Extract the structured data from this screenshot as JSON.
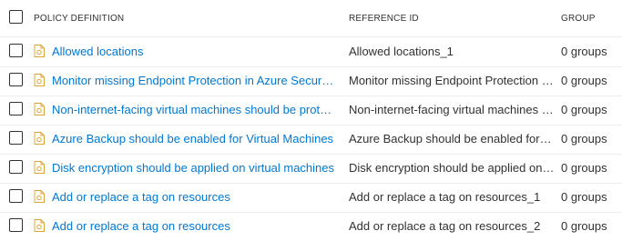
{
  "table": {
    "headers": {
      "policy_definition": "POLICY DEFINITION",
      "reference_id": "REFERENCE ID",
      "group": "GROUP"
    },
    "rows": [
      {
        "policy_definition": "Allowed locations",
        "reference_id": "Allowed locations_1",
        "group": "0 groups"
      },
      {
        "policy_definition": "Monitor missing Endpoint Protection in Azure Security Center",
        "reference_id": "Monitor missing Endpoint Protection in Azure Security Center",
        "group": "0 groups"
      },
      {
        "policy_definition": "Non-internet-facing virtual machines should be protected with network security groups",
        "reference_id": "Non-internet-facing virtual machines should be protected with network security groups",
        "group": "0 groups"
      },
      {
        "policy_definition": "Azure Backup should be enabled for Virtual Machines",
        "reference_id": "Azure Backup should be enabled for Virtual Machines",
        "group": "0 groups"
      },
      {
        "policy_definition": "Disk encryption should be applied on virtual machines",
        "reference_id": "Disk encryption should be applied on virtual machines",
        "group": "0 groups"
      },
      {
        "policy_definition": "Add or replace a tag on resources",
        "reference_id": "Add or replace a tag on resources_1",
        "group": "0 groups"
      },
      {
        "policy_definition": "Add or replace a tag on resources",
        "reference_id": "Add or replace a tag on resources_2",
        "group": "0 groups"
      }
    ]
  },
  "icons": {
    "row_icon": "policy-definition-icon",
    "icon_color": "#d8a437"
  },
  "colors": {
    "link": "#0078d4",
    "text": "#323130",
    "divider": "#edebe9"
  }
}
